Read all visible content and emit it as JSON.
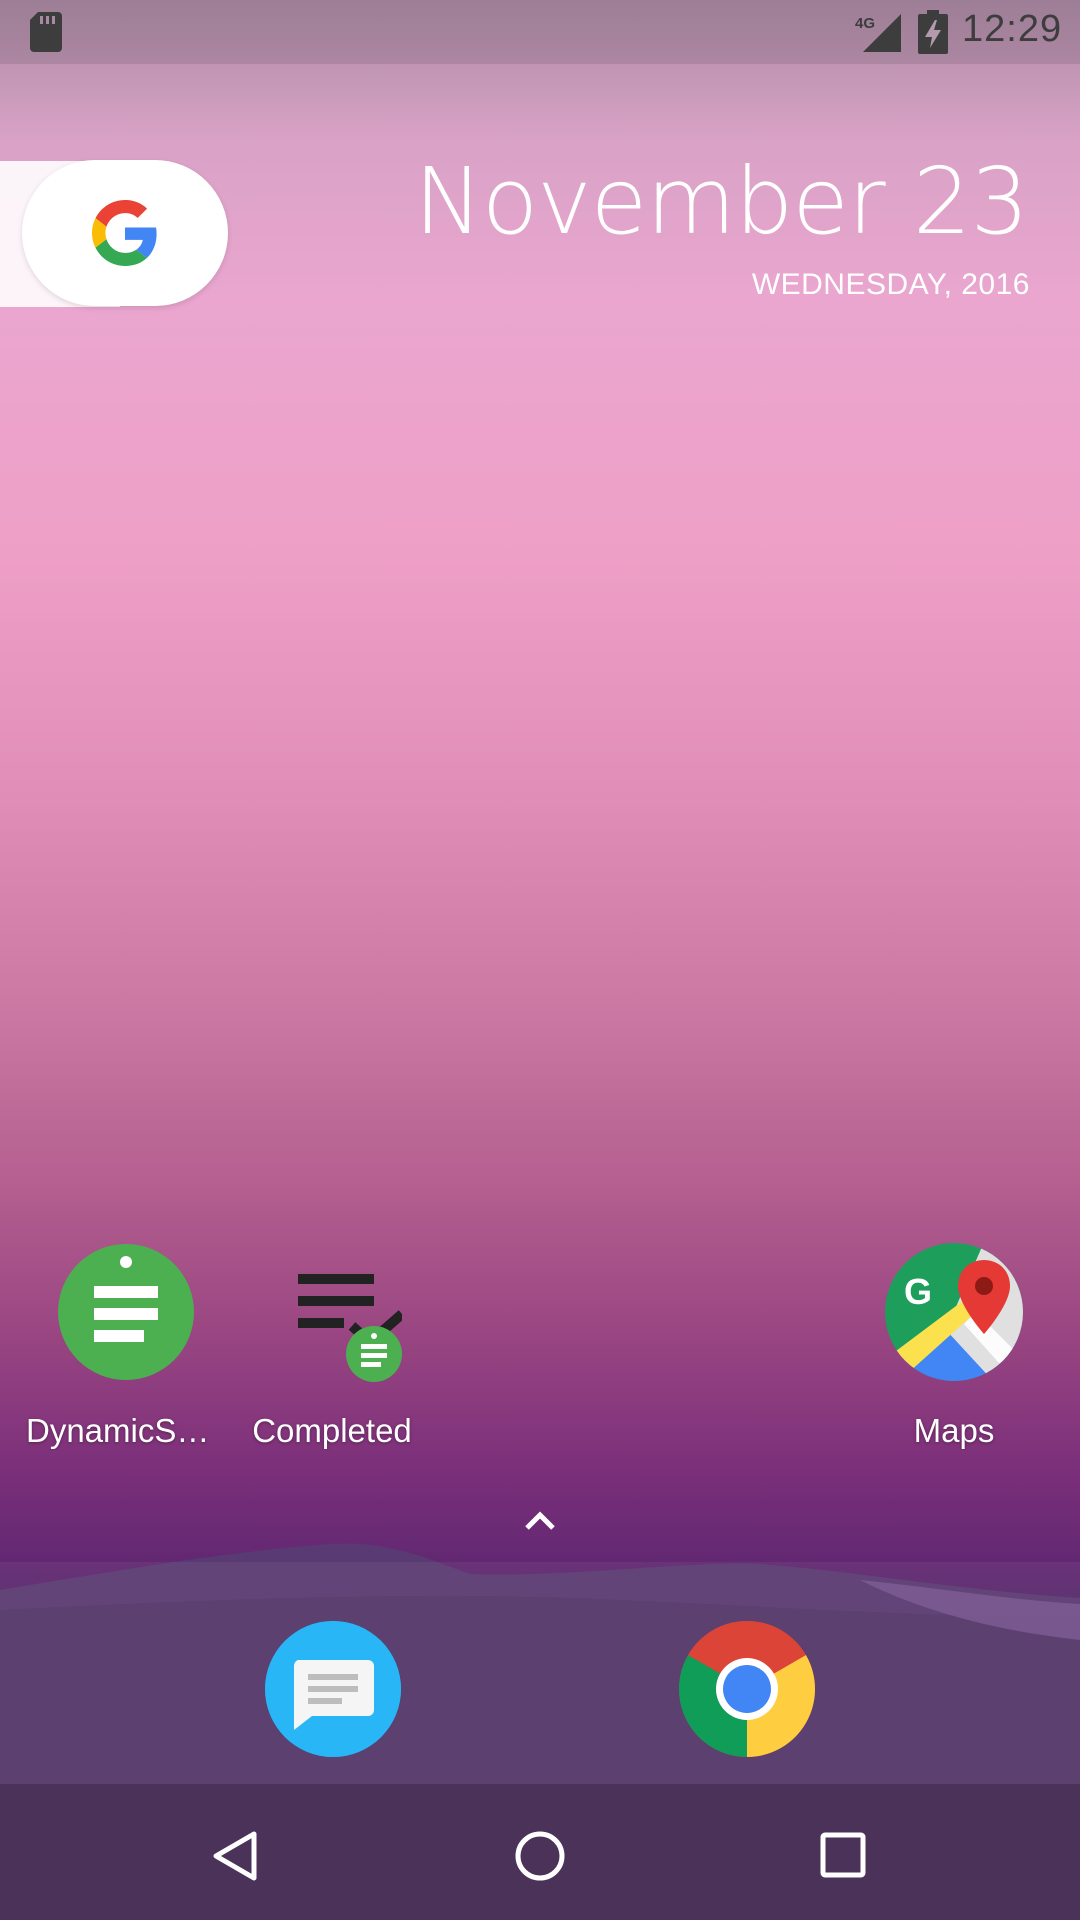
{
  "status_bar": {
    "time": "12:29",
    "network_label": "4G",
    "icons": [
      "sd-card-icon",
      "network-4g-icon",
      "battery-charging-icon"
    ]
  },
  "search_widget": {
    "icon": "google-g-icon"
  },
  "date_widget": {
    "date": "November 23",
    "day_year": "WEDNESDAY, 2016"
  },
  "desktop_apps": [
    {
      "label": "DynamicSho..",
      "icon": "dynamic-shortcuts-app-icon"
    },
    {
      "label": "Completed",
      "icon": "completed-shortcut-icon"
    },
    {
      "label": "Maps",
      "icon": "maps-app-icon"
    }
  ],
  "app_drawer": {
    "icon": "chevron-up-icon"
  },
  "dock": [
    {
      "icon": "messages-app-icon"
    },
    {
      "icon": "chrome-app-icon"
    }
  ],
  "navigation": {
    "buttons": [
      "back-icon",
      "home-icon",
      "recents-icon"
    ]
  },
  "colors": {
    "app_green": "#4CAF50",
    "nav_bar": "#4b3258",
    "google_blue": "#4285F4",
    "google_red": "#EA4335",
    "google_yellow": "#FBBC05",
    "google_green": "#34A853"
  }
}
